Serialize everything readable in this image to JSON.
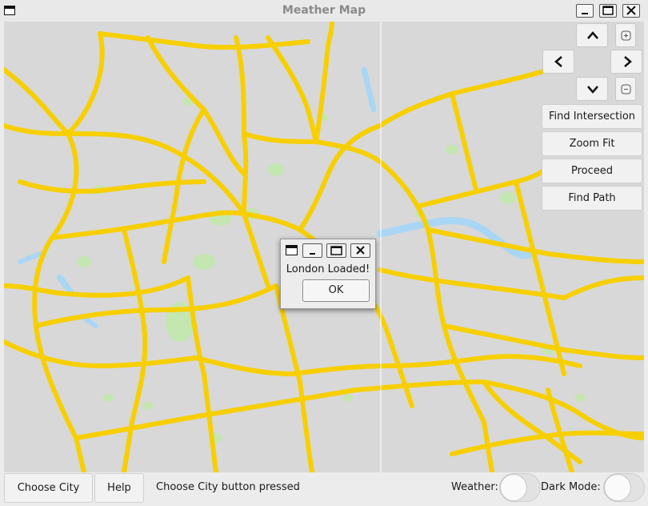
{
  "window": {
    "title": "Meather Map"
  },
  "sidebar": {
    "buttons": [
      {
        "label": "Find Intersection"
      },
      {
        "label": "Zoom Fit"
      },
      {
        "label": "Proceed"
      },
      {
        "label": "Find Path"
      }
    ]
  },
  "nav_icons": {
    "up": "chevron-up-icon",
    "down": "chevron-down-icon",
    "left": "chevron-left-icon",
    "right": "chevron-right-icon",
    "zoom_in": "zoom-in-icon",
    "zoom_out": "zoom-out-icon"
  },
  "dialog": {
    "message": "London Loaded!",
    "ok_label": "OK"
  },
  "statusbar": {
    "choose_city_label": "Choose City",
    "help_label": "Help",
    "status_text": "Choose City button pressed",
    "weather_label": "Weather:",
    "dark_mode_label": "Dark Mode:"
  },
  "colors": {
    "road": "#f7cf00",
    "map_background": "#d8d8d8",
    "park": "#c4e6b0",
    "water": "#a9d6f5"
  }
}
